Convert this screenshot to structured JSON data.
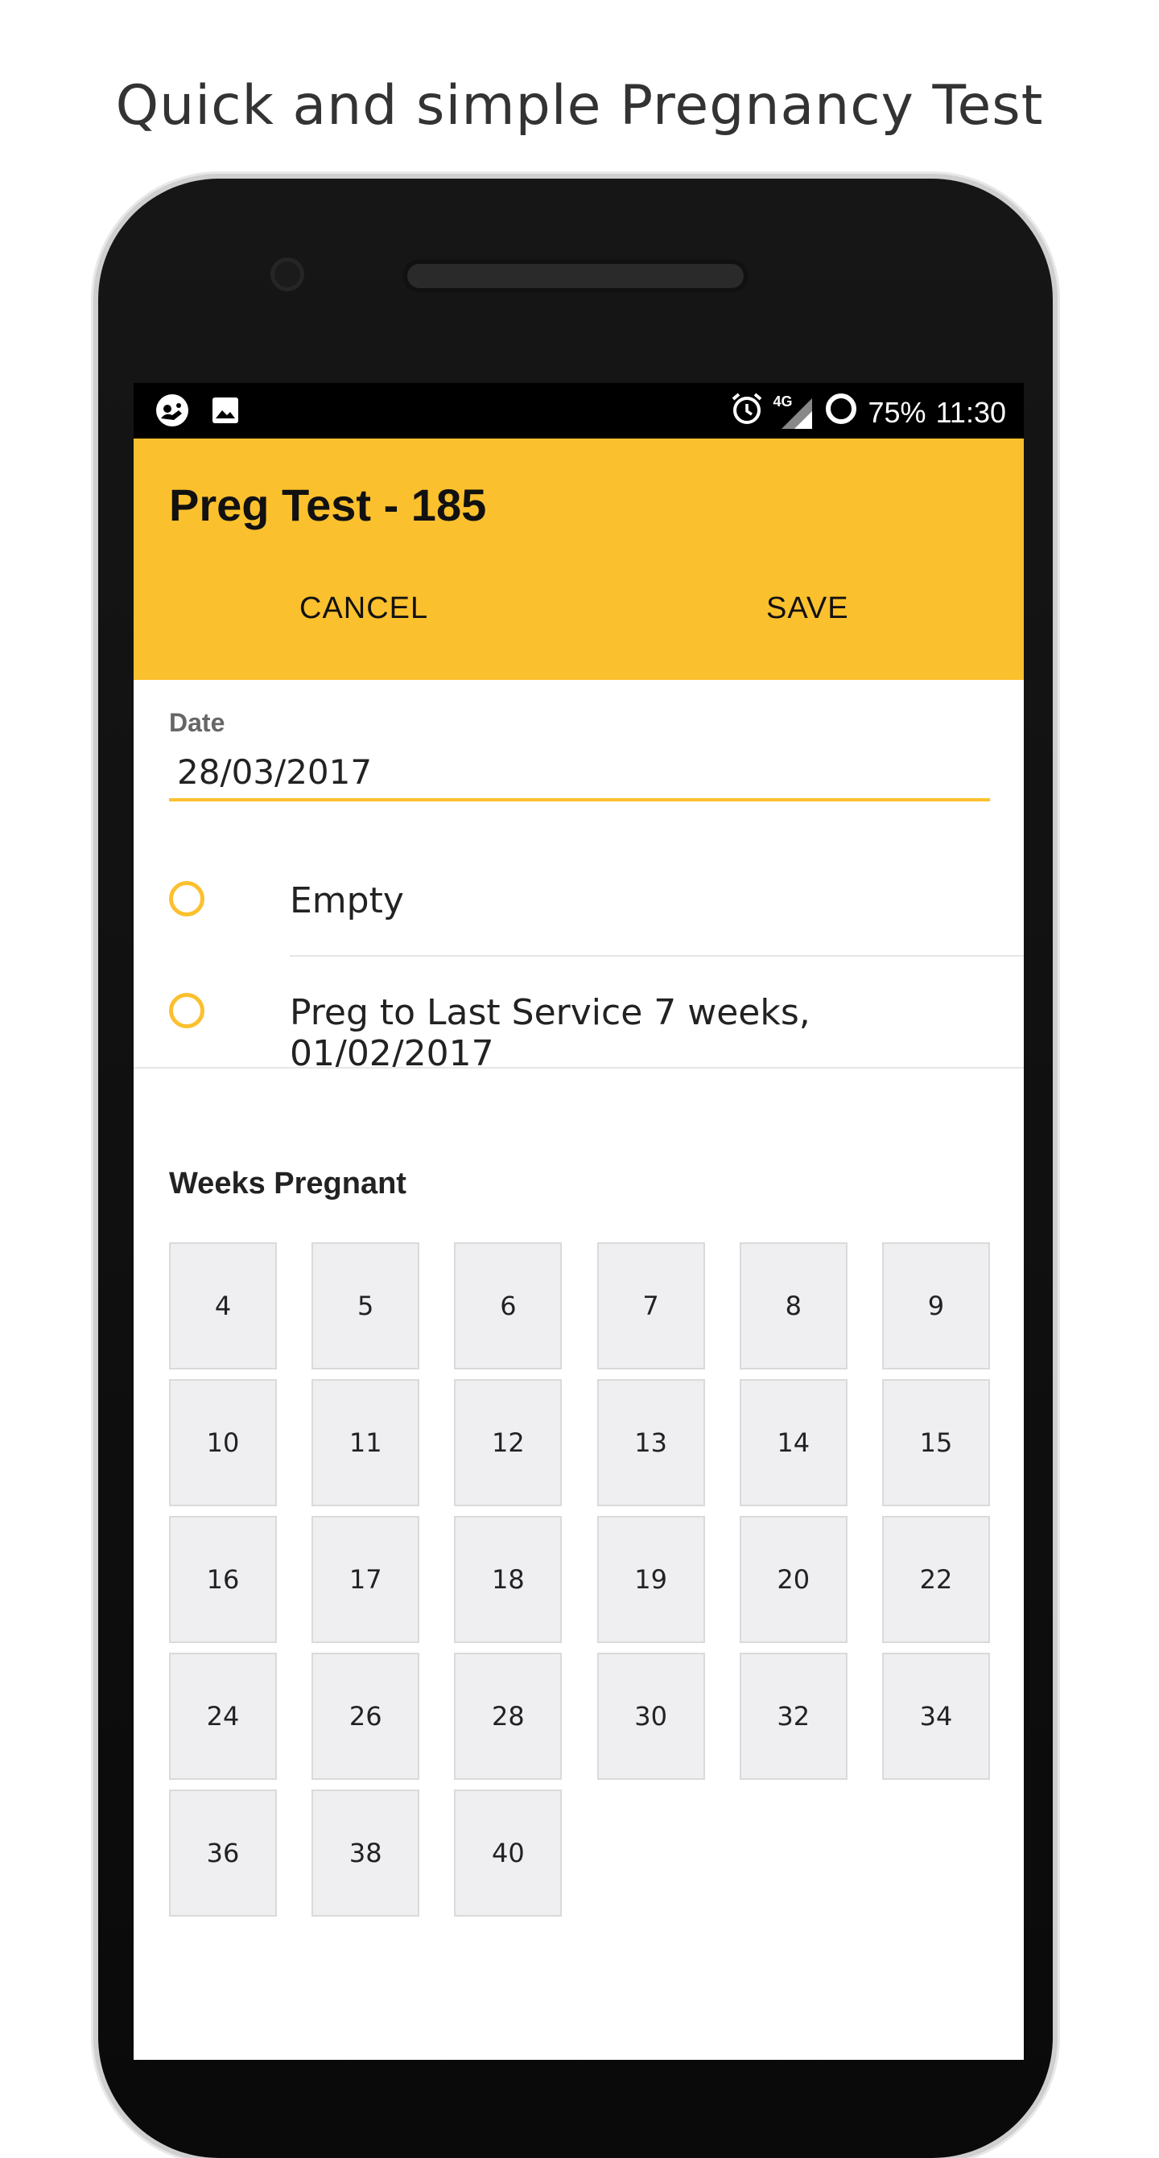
{
  "headline": "Quick and simple Pregnancy Test",
  "status_bar": {
    "left_icons": [
      "app-notification-icon",
      "image-icon"
    ],
    "right_icons": [
      "alarm-icon",
      "signal-4g-icon",
      "battery-icon"
    ],
    "network": "4G",
    "battery": "75%",
    "time": "11:30"
  },
  "appbar": {
    "title": "Preg Test - 185",
    "cancel_label": "CANCEL",
    "save_label": "SAVE",
    "color": "#fbc02d"
  },
  "form": {
    "date_label": "Date",
    "date_value": "28/03/2017",
    "options": [
      {
        "label": "Empty",
        "selected": false
      },
      {
        "label": "Preg to Last Service 7 weeks, 01/02/2017",
        "selected": false
      }
    ]
  },
  "weeks": {
    "heading": "Weeks Pregnant",
    "values": [
      "4",
      "5",
      "6",
      "7",
      "8",
      "9",
      "10",
      "11",
      "12",
      "13",
      "14",
      "15",
      "16",
      "17",
      "18",
      "19",
      "20",
      "22",
      "24",
      "26",
      "28",
      "30",
      "32",
      "34",
      "36",
      "38",
      "40"
    ]
  }
}
